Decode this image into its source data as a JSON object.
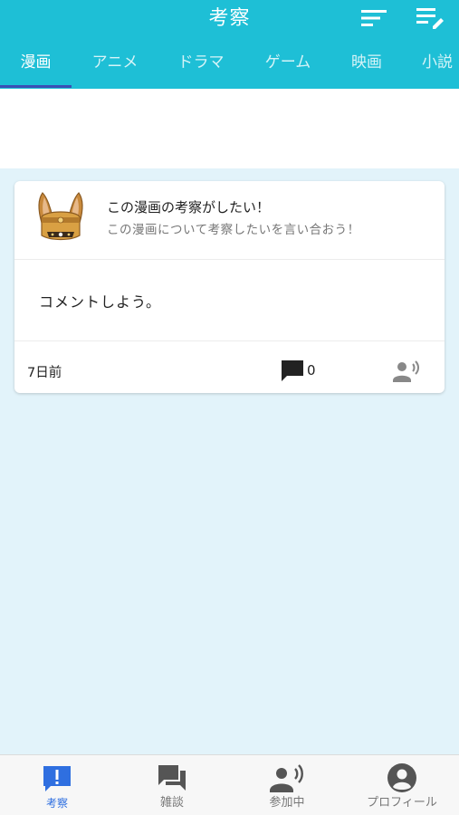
{
  "header": {
    "title": "考察"
  },
  "tabs": [
    {
      "label": "漫画",
      "active": true
    },
    {
      "label": "アニメ",
      "active": false
    },
    {
      "label": "ドラマ",
      "active": false
    },
    {
      "label": "ゲーム",
      "active": false
    },
    {
      "label": "映画",
      "active": false
    },
    {
      "label": "小説",
      "active": false
    }
  ],
  "post": {
    "title": "この漫画の考察がしたい！",
    "subtitle": "この漫画について考察したいを言い合おう！",
    "body": "コメントしよう。",
    "time": "7日前",
    "comment_count": "0"
  },
  "bottom_nav": [
    {
      "label": "考察",
      "icon": "exclamation-chat-icon",
      "active": true
    },
    {
      "label": "雑談",
      "icon": "forum-icon",
      "active": false
    },
    {
      "label": "参加中",
      "icon": "voice-user-icon",
      "active": false
    },
    {
      "label": "プロフィール",
      "icon": "account-circle-icon",
      "active": false
    }
  ],
  "colors": {
    "header": "#1ebfd6",
    "background": "#e2f3fa",
    "tab_indicator": "#3b4fb5",
    "nav_active": "#2f6fe0"
  }
}
